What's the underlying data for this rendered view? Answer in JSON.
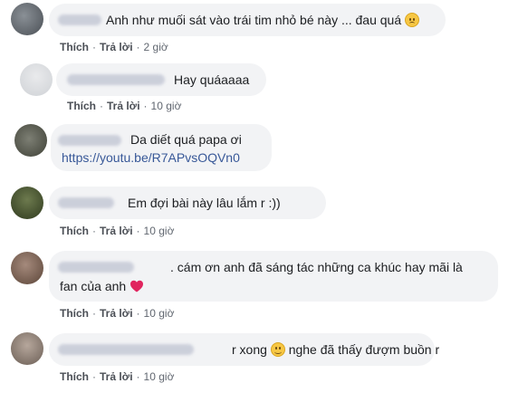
{
  "comments": [
    {
      "text": "Anh như muối sát vào trái tim nhỏ bé này ... đau quá",
      "emoji": "sad-face-emoji",
      "like": "Thích",
      "reply": "Trả lời",
      "time": "2 giờ"
    },
    {
      "text": "Hay quáaaaa",
      "like": "Thích",
      "reply": "Trả lời",
      "time": "10 giờ"
    },
    {
      "text": "Da diết quá papa ơi",
      "link": "https://youtu.be/R7APvsOQVn0"
    },
    {
      "text": "Em đợi bài này lâu lắm r :))",
      "like": "Thích",
      "reply": "Trả lời",
      "time": "10 giờ"
    },
    {
      "text_line1": ". cám ơn anh đã sáng tác những ca khúc hay mãi là",
      "text_line2": "fan của anh",
      "emoji": "red-heart-emoji",
      "like": "Thích",
      "reply": "Trả lời",
      "time": "10 giờ"
    },
    {
      "text_before": "r xong",
      "emoji": "smiling-face-emoji",
      "text_after": "nghe đã thấy đượm buồn r",
      "like": "Thích",
      "reply": "Trả lời",
      "time": "10 giờ"
    }
  ],
  "colors": {
    "bubble": "#f2f3f5",
    "link": "#385898",
    "heart": "#e0245e",
    "emoji": "#f7c744"
  }
}
